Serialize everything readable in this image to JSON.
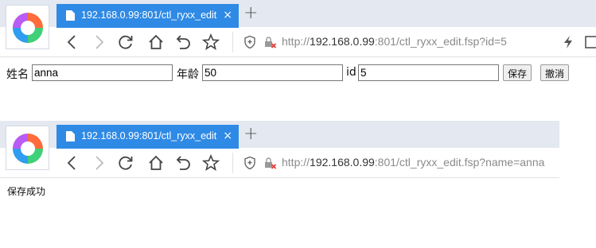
{
  "window1": {
    "tab": {
      "title": "192.168.0.99:801/ctl_ryxx_edit",
      "close": "×"
    },
    "new_tab": "+",
    "url": {
      "scheme": "http://",
      "host": "192.168.0.99",
      "path": ":801/ctl_ryxx_edit.fsp?id=5"
    }
  },
  "form": {
    "name_label": "姓名",
    "name_value": "anna",
    "age_label": "年龄",
    "age_value": "50",
    "id_label": "id",
    "id_value": "5",
    "save_button": "保存",
    "cancel_button": "撤消"
  },
  "window2": {
    "tab": {
      "title": "192.168.0.99:801/ctl_ryxx_edit",
      "close": "×"
    },
    "new_tab": "+",
    "url": {
      "scheme": "http://",
      "host": "192.168.0.99",
      "path": ":801/ctl_ryxx_edit.fsp?name=anna"
    }
  },
  "result": {
    "message": "保存成功"
  },
  "colors": {
    "tab_active": "#2f8ae5",
    "tab_strip": "#e3e8f1",
    "url_host": "#333333",
    "url_rest": "#8a8a8a"
  }
}
